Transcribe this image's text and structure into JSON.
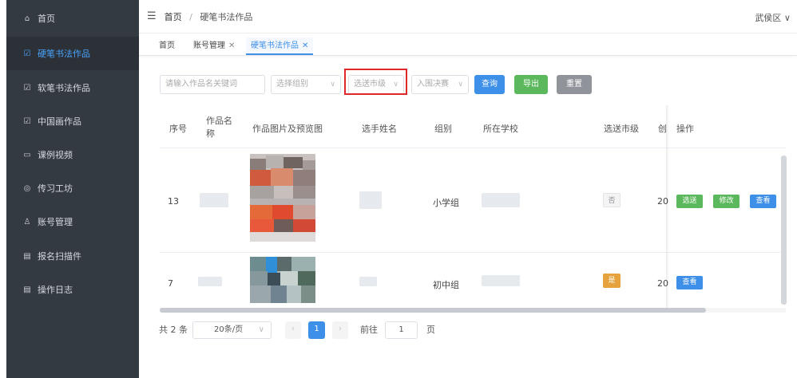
{
  "sidebar": {
    "items": [
      {
        "label": "首页",
        "icon": "home-icon",
        "glyph": "⌂"
      },
      {
        "label": "硬笔书法作品",
        "icon": "checkbox-icon",
        "glyph": "☑"
      },
      {
        "label": "软笔书法作品",
        "icon": "checkbox-icon",
        "glyph": "☑"
      },
      {
        "label": "中国画作品",
        "icon": "checkbox-icon",
        "glyph": "☑"
      },
      {
        "label": "课例视频",
        "icon": "video-icon",
        "glyph": "▭"
      },
      {
        "label": "传习工坊",
        "icon": "location-icon",
        "glyph": "◎"
      },
      {
        "label": "账号管理",
        "icon": "user-icon",
        "glyph": "♙"
      },
      {
        "label": "报名扫描件",
        "icon": "document-icon",
        "glyph": "▤"
      },
      {
        "label": "操作日志",
        "icon": "document-icon",
        "glyph": "▤"
      }
    ],
    "active_index": 1,
    "colors": {
      "bg": "#333a41",
      "active_text": "#4aa3ff"
    }
  },
  "header": {
    "menu_icon": "hamburger-icon",
    "breadcrumb": [
      "首页",
      "硬笔书法作品"
    ],
    "breadcrumb_sep": "/",
    "user": "武侯区 ∨"
  },
  "tabs": [
    {
      "label": "首页",
      "closable": false
    },
    {
      "label": "账号管理",
      "closable": true
    },
    {
      "label": "硬笔书法作品",
      "closable": true,
      "active": true
    }
  ],
  "filters": {
    "keyword_placeholder": "请输入作品名关键词",
    "group_placeholder": "选择组别",
    "city_level_placeholder": "选送市级",
    "final_placeholder": "入围决赛"
  },
  "buttons": {
    "search": "查询",
    "export": "导出",
    "reset": "重置"
  },
  "colors": {
    "primary": "#3d8fe8",
    "success": "#5cb85c",
    "warning": "#e6a23c",
    "info": "#909399",
    "highlight_box": "#e0282a"
  },
  "table": {
    "columns": [
      "序号",
      "作品名称",
      "作品图片及预览图",
      "选手姓名",
      "组别",
      "所在学校",
      "选送市级",
      "创",
      "操作"
    ],
    "column_name_line1": "作品名",
    "column_name_line2": "称",
    "rows": [
      {
        "index": "13",
        "group": "小学组",
        "city_level": "否",
        "created": "20",
        "actions": [
          "选送",
          "修改",
          "查看"
        ]
      },
      {
        "index": "7",
        "group": "初中组",
        "city_level": "是",
        "created": "20",
        "actions": [
          "查看"
        ]
      }
    ]
  },
  "pagination": {
    "total": "共 2 条",
    "page_size": "20条/页",
    "current_page": "1",
    "goto_label": "前往",
    "goto_value": "1",
    "page_suffix": "页"
  }
}
